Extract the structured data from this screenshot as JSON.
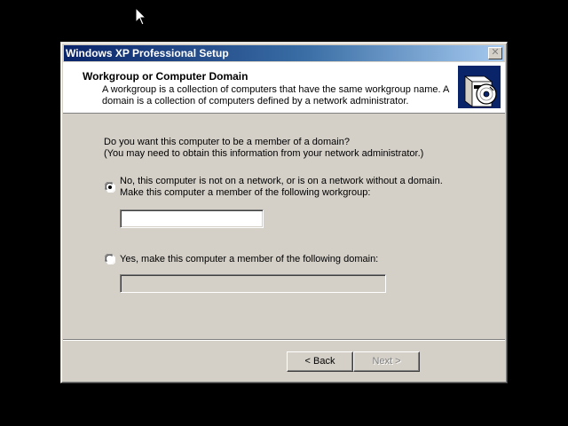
{
  "window": {
    "title": "Windows XP Professional Setup",
    "close_symbol": "✕"
  },
  "header": {
    "title": "Workgroup or Computer Domain",
    "description": "A workgroup is a collection of computers that have the same workgroup name.  A domain is a collection of computers defined by a network administrator.",
    "icon": "setup-box-cd-icon"
  },
  "question": {
    "line1": "Do you want this computer to be a member of a domain?",
    "line2": "(You may need to obtain this information from your network administrator.)"
  },
  "option_workgroup": {
    "line1": "No, this computer is not on a network, or is on a network without a domain.",
    "line2": "Make this computer a member of the following workgroup:",
    "selected": true,
    "input_value": ""
  },
  "option_domain": {
    "label": "Yes, make this computer a member of the following domain:",
    "selected": false,
    "input_value": ""
  },
  "buttons": {
    "back_label": "< Back",
    "next_label": "Next >"
  },
  "colors": {
    "dialog_face": "#d4d0c8",
    "titlebar_start": "#0a246a",
    "titlebar_end": "#a6caf0",
    "desktop": "#000000"
  }
}
